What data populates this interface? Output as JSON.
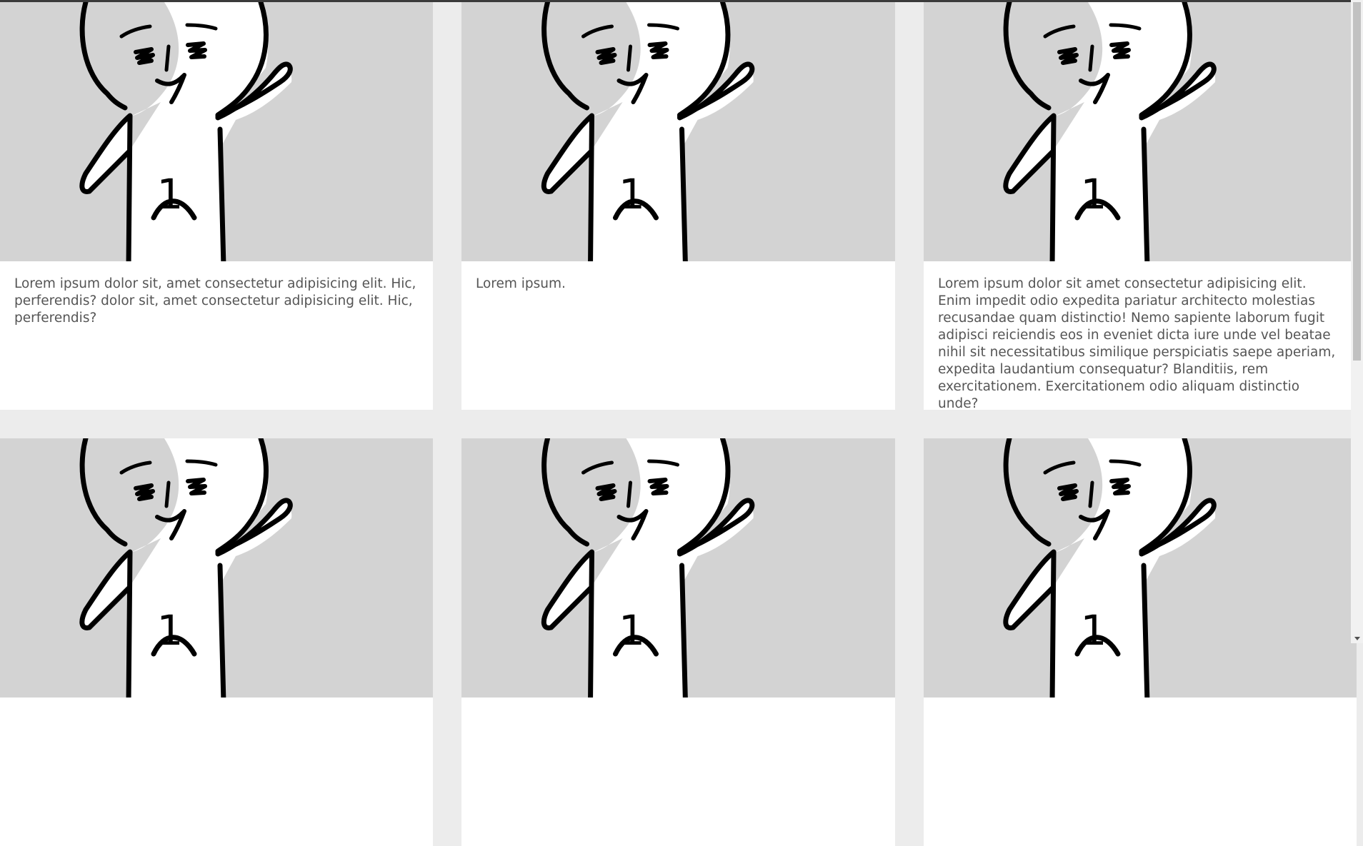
{
  "colors": {
    "page_background": "#ececec",
    "card_background": "#ffffff",
    "image_background": "#d3d3d3",
    "text": "#555555"
  },
  "cards": [
    {
      "image_icon": "waving-stick-figure-number-1",
      "text": "Lorem ipsum dolor sit, amet consectetur adipisicing elit. Hic, perferendis? dolor sit, amet consectetur adipisicing elit. Hic, perferendis?"
    },
    {
      "image_icon": "waving-stick-figure-number-1",
      "text": "Lorem ipsum."
    },
    {
      "image_icon": "waving-stick-figure-number-1",
      "text": "Lorem ipsum dolor sit amet consectetur adipisicing elit. Enim impedit odio expedita pariatur architecto molestias recusandae quam distinctio! Nemo sapiente laborum fugit adipisci reiciendis eos in eveniet dicta iure unde vel beatae nihil sit necessitatibus similique perspiciatis saepe aperiam, expedita laudantium consequatur? Blanditiis, rem exercitationem. Exercitationem odio aliquam distinctio unde?"
    },
    {
      "image_icon": "waving-stick-figure-number-1",
      "text": ""
    },
    {
      "image_icon": "waving-stick-figure-number-1",
      "text": ""
    },
    {
      "image_icon": "waving-stick-figure-number-1",
      "text": ""
    }
  ],
  "figure_label": "1",
  "scrollbar": {
    "position_fraction": 0
  }
}
